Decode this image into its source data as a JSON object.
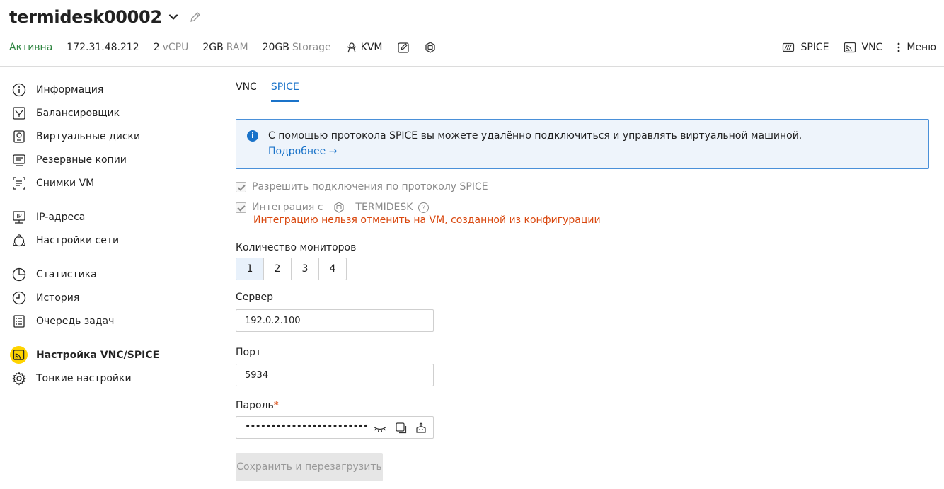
{
  "header": {
    "vm_name": "termidesk00002",
    "status": "Активна",
    "ip": "172.31.48.212",
    "vcpu_num": "2",
    "vcpu_unit": "vCPU",
    "ram_num": "2GB",
    "ram_unit": "RAM",
    "storage_num": "20GB",
    "storage_unit": "Storage",
    "hypervisor": "KVM",
    "actions": {
      "spice": "SPICE",
      "vnc": "VNC",
      "menu": "Меню"
    }
  },
  "sidebar": {
    "items": [
      {
        "label": "Информация",
        "icon": "info-icon"
      },
      {
        "label": "Балансировщик",
        "icon": "balancer-icon"
      },
      {
        "label": "Виртуальные диски",
        "icon": "disk-icon"
      },
      {
        "label": "Резервные копии",
        "icon": "backup-icon"
      },
      {
        "label": "Снимки VM",
        "icon": "snapshot-icon"
      },
      {
        "label": "IP-адреса",
        "icon": "ip-icon"
      },
      {
        "label": "Настройки сети",
        "icon": "network-icon"
      },
      {
        "label": "Статистика",
        "icon": "stats-icon"
      },
      {
        "label": "История",
        "icon": "history-icon"
      },
      {
        "label": "Очередь задач",
        "icon": "queue-icon"
      },
      {
        "label": "Настройка VNC/SPICE",
        "icon": "vnc-spice-icon"
      },
      {
        "label": "Тонкие настройки",
        "icon": "gear-icon"
      }
    ],
    "active_index": 10
  },
  "main": {
    "tabs": [
      {
        "label": "VNC"
      },
      {
        "label": "SPICE"
      }
    ],
    "active_tab": "SPICE",
    "info": {
      "text": "С помощью протокола SPICE вы можете удалённо подключиться и управлять виртуальной машиной.",
      "link": "Подробнее →"
    },
    "allow_spice_label": "Разрешить подключения по протоколу SPICE",
    "integration_prefix": "Интеграция с",
    "integration_name": "TERMIDESK",
    "integration_warning": "Интеграцию нельзя отменить на VM, созданной из конфигурации",
    "monitors_label": "Количество мониторов",
    "monitors": [
      "1",
      "2",
      "3",
      "4"
    ],
    "monitors_selected": "1",
    "server_label": "Сервер",
    "server_value": "192.0.2.100",
    "port_label": "Порт",
    "port_value": "5934",
    "password_label": "Пароль",
    "password_required_mark": "*",
    "password_mask": "••••••••••••••••••••••••",
    "save_label": "Сохранить и перезагрузить"
  },
  "colors": {
    "accent": "#1a73c9",
    "status_active": "#2e8540",
    "warning": "#d9480f",
    "active_highlight": "#ffd400"
  }
}
